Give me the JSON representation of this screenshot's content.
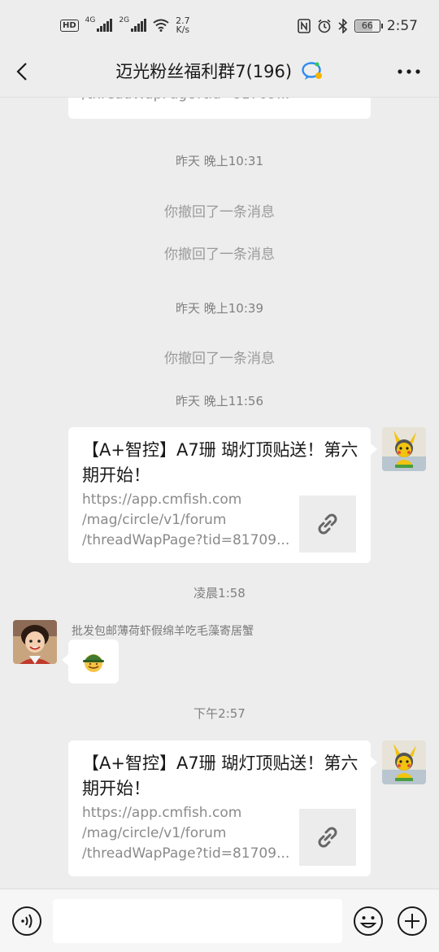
{
  "status_bar": {
    "hd": "HD",
    "sim1_net": "4G",
    "sim2_net": "2G",
    "speed_value": "2.7",
    "speed_unit": "K/s",
    "battery": "66",
    "time": "2:57"
  },
  "header": {
    "title": "迈光粉丝福利群7(196)"
  },
  "messages": {
    "top_card": {
      "desc_line3": "/threadWapPage?tid=81709..."
    },
    "time1": "昨天 晚上10:31",
    "revoke1": "你撤回了一条消息",
    "revoke2": "你撤回了一条消息",
    "time2": "昨天 晚上10:39",
    "revoke3": "你撤回了一条消息",
    "time3": "昨天 晚上11:56",
    "card1": {
      "title": "【A+智控】A7珊 瑚灯顶贴送！第六期开始！",
      "desc_line1": "https://app.cmfish.com",
      "desc_line2": "/mag/circle/v1/forum",
      "desc_line3": "/threadWapPage?tid=81709..."
    },
    "time4": "凌晨1:58",
    "other_sender": "批发包邮薄荷虾假绵羊吃毛藻寄居蟹",
    "time5": "下午2:57",
    "card2": {
      "title": "【A+智控】A7珊 瑚灯顶贴送！第六期开始！",
      "desc_line1": "https://app.cmfish.com",
      "desc_line2": "/mag/circle/v1/forum",
      "desc_line3": "/threadWapPage?tid=81709..."
    }
  },
  "input": {
    "value": ""
  },
  "colors": {
    "background": "#ededed",
    "bubble": "#ffffff",
    "system_text": "#9a9a9a",
    "time_text": "#808080"
  }
}
